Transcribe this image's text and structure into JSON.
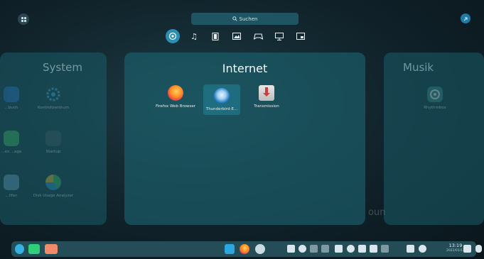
{
  "search": {
    "label": "Suchen"
  },
  "categories": [
    {
      "icon": "all-apps-icon",
      "active": true
    },
    {
      "icon": "music-icon"
    },
    {
      "icon": "video-icon"
    },
    {
      "icon": "image-icon"
    },
    {
      "icon": "gamepad-icon"
    },
    {
      "icon": "presentation-icon"
    },
    {
      "icon": "office-icon"
    }
  ],
  "panels": {
    "system": {
      "title": "System",
      "apps": [
        {
          "label": "...buch",
          "icon": "book-icon"
        },
        {
          "label": "Kontrollzentrum",
          "icon": "control-center-icon"
        },
        {
          "label": "...es ...age",
          "icon": "app-icon"
        },
        {
          "label": "Startup",
          "icon": "startup-icon"
        },
        {
          "label": "...ilfen",
          "icon": "app-icon"
        },
        {
          "label": "Disk Usage Analyzer",
          "icon": "disk-usage-icon"
        }
      ]
    },
    "internet": {
      "title": "Internet",
      "apps": [
        {
          "label": "Firefox Web Browser",
          "icon": "firefox-icon"
        },
        {
          "label": "Thunderbird-E...",
          "icon": "thunderbird-icon"
        },
        {
          "label": "Transmission",
          "icon": "transmission-icon"
        }
      ]
    },
    "musik": {
      "title": "Musik",
      "apps": [
        {
          "label": "Rhythmbox",
          "icon": "rhythmbox-icon"
        }
      ]
    }
  },
  "watermark": "oun",
  "dock": {
    "clock_time": "13:19",
    "clock_date": "2022/01/11"
  },
  "colors": {
    "accent": "#2b8fb3",
    "panel": "#1c6470"
  }
}
